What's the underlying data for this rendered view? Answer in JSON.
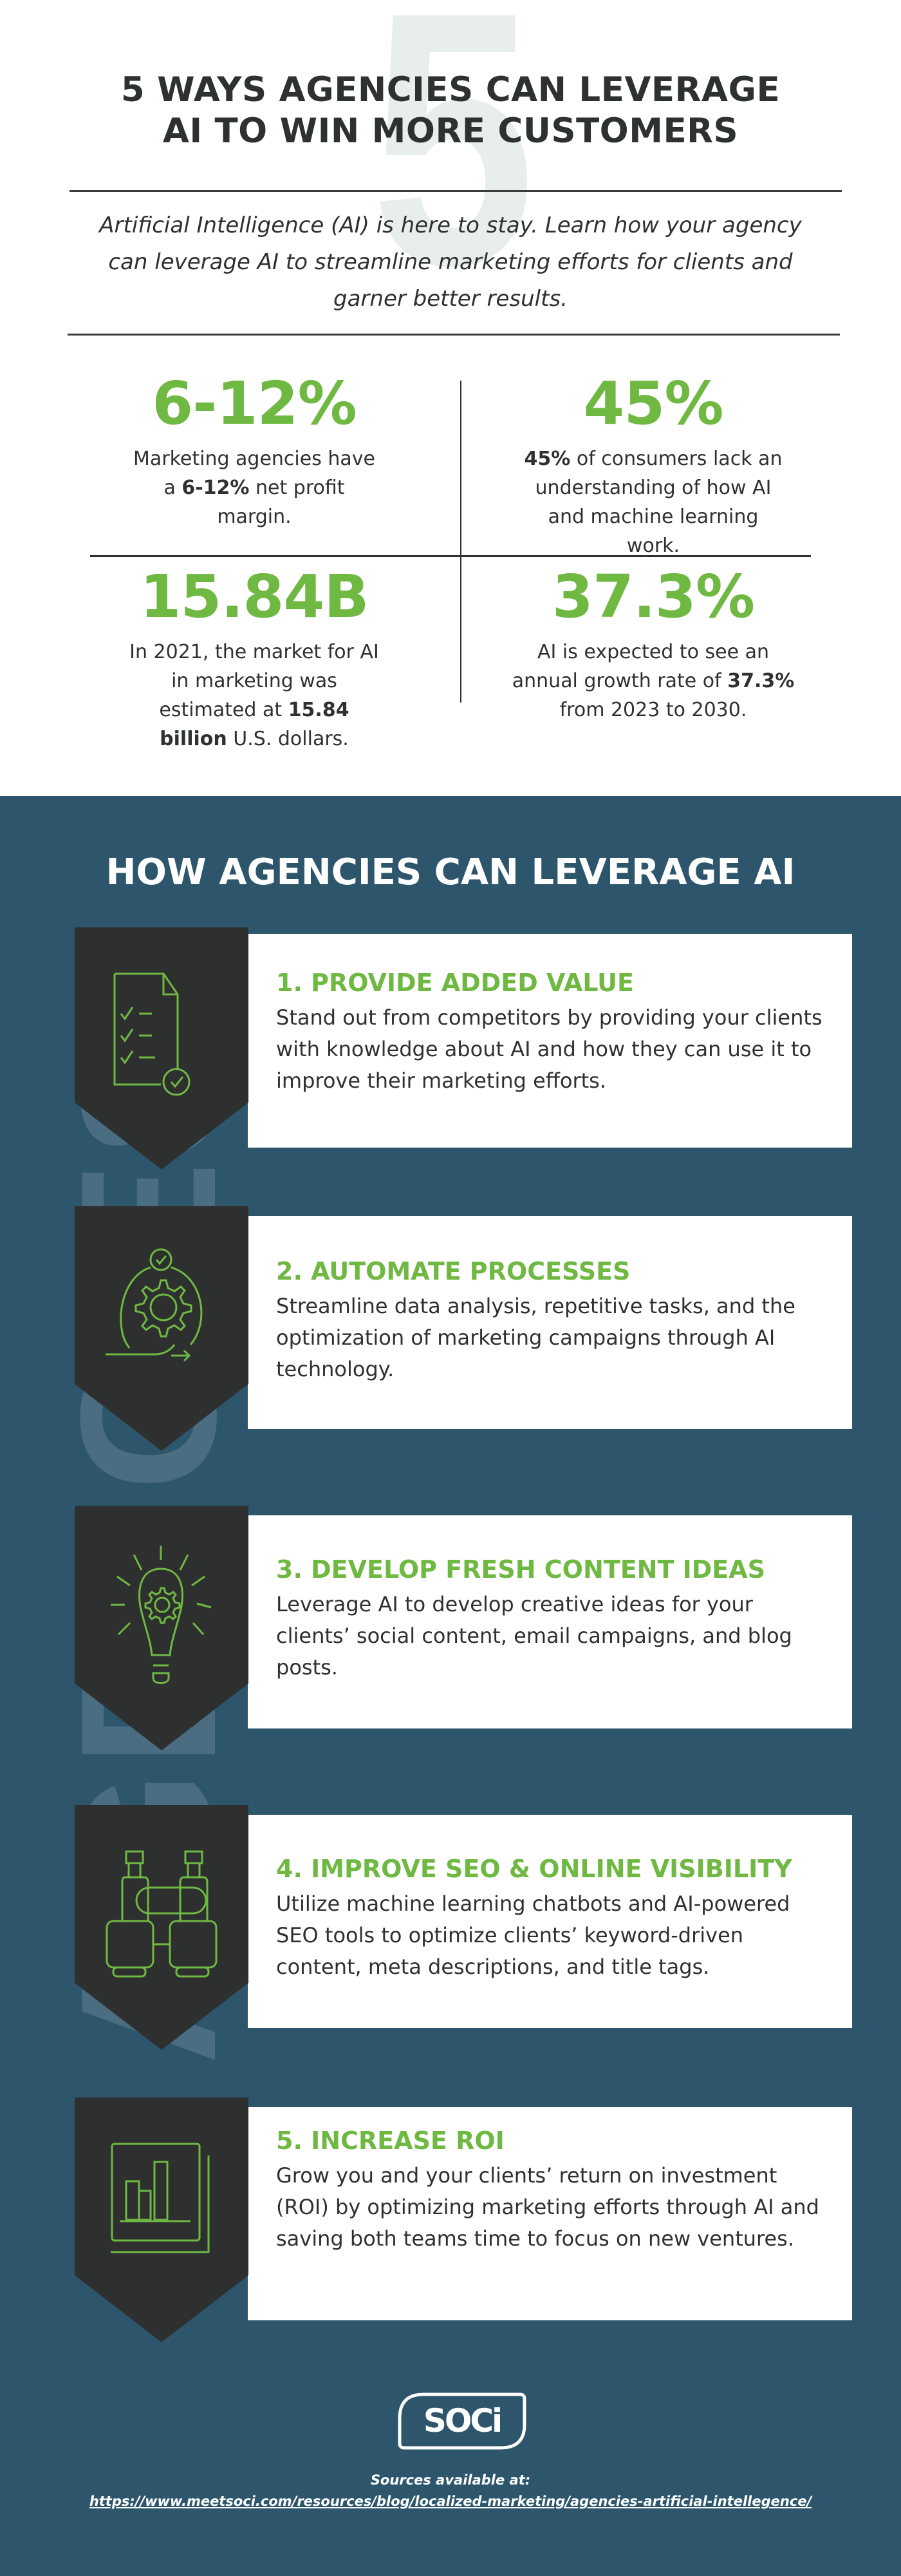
{
  "colors": {
    "accent_green": "#6fb842",
    "dark_text": "#2e3131",
    "section_blue": "#2d566c",
    "badge_dark": "#2e3030",
    "watermark": "#e8eeec"
  },
  "header": {
    "watermark_digit": "5",
    "title_line1": "5 WAYS AGENCIES CAN LEVERAGE",
    "title_line2": "AI TO WIN MORE CUSTOMERS",
    "intro": "Artificial Intelligence (AI) is here to stay. Learn how your agency can leverage AI to streamline marketing efforts for clients and garner better results."
  },
  "stats": [
    {
      "value": "6-12%",
      "text_before": "Marketing agencies have a ",
      "bold": "6-12%",
      "text_after": " net profit margin."
    },
    {
      "value": "45%",
      "text_before": "",
      "bold": "45%",
      "text_after": " of consumers lack an understanding of how AI and machine learning work."
    },
    {
      "value": "15.84B",
      "text_before": "In 2021, the market for AI in marketing was estimated at ",
      "bold": "15.84 billion",
      "text_after": " U.S. dollars."
    },
    {
      "value": "37.3%",
      "text_before": "AI is expected to see an annual growth rate of ",
      "bold": "37.3%",
      "text_after": " from 2023 to 2030."
    }
  ],
  "section": {
    "background_word": "AGENCIES",
    "title": "HOW AGENCIES CAN LEVERAGE AI",
    "items": [
      {
        "icon": "checklist-document-icon",
        "title": "1. PROVIDE ADDED VALUE",
        "text": "Stand out from competitors by providing your clients with knowledge about AI and how they can use it to improve their marketing efforts."
      },
      {
        "icon": "gear-cycle-icon",
        "title": "2. AUTOMATE PROCESSES",
        "text": "Streamline data analysis, repetitive tasks, and the optimization of marketing campaigns through AI technology."
      },
      {
        "icon": "lightbulb-gear-icon",
        "title": "3. DEVELOP FRESH CONTENT IDEAS",
        "text": "Leverage AI to develop creative ideas for your clients’ social content, email campaigns, and blog posts."
      },
      {
        "icon": "binoculars-icon",
        "title": "4. IMPROVE SEO & ONLINE VISIBILITY",
        "text": "Utilize machine learning chatbots and AI-powered SEO tools to optimize clients’ keyword-driven content, meta descriptions, and title tags."
      },
      {
        "icon": "bar-chart-icon",
        "title": "5. INCREASE ROI",
        "text": "Grow you and your clients’ return on investment (ROI) by optimizing marketing efforts through AI and saving both teams time to focus on new ventures."
      }
    ]
  },
  "footer": {
    "logo_text": "SOCi",
    "sources_label": "Sources available at:",
    "sources_url": "https://www.meetsoci.com/resources/blog/localized-marketing/agencies-artificial-intellegence/"
  }
}
